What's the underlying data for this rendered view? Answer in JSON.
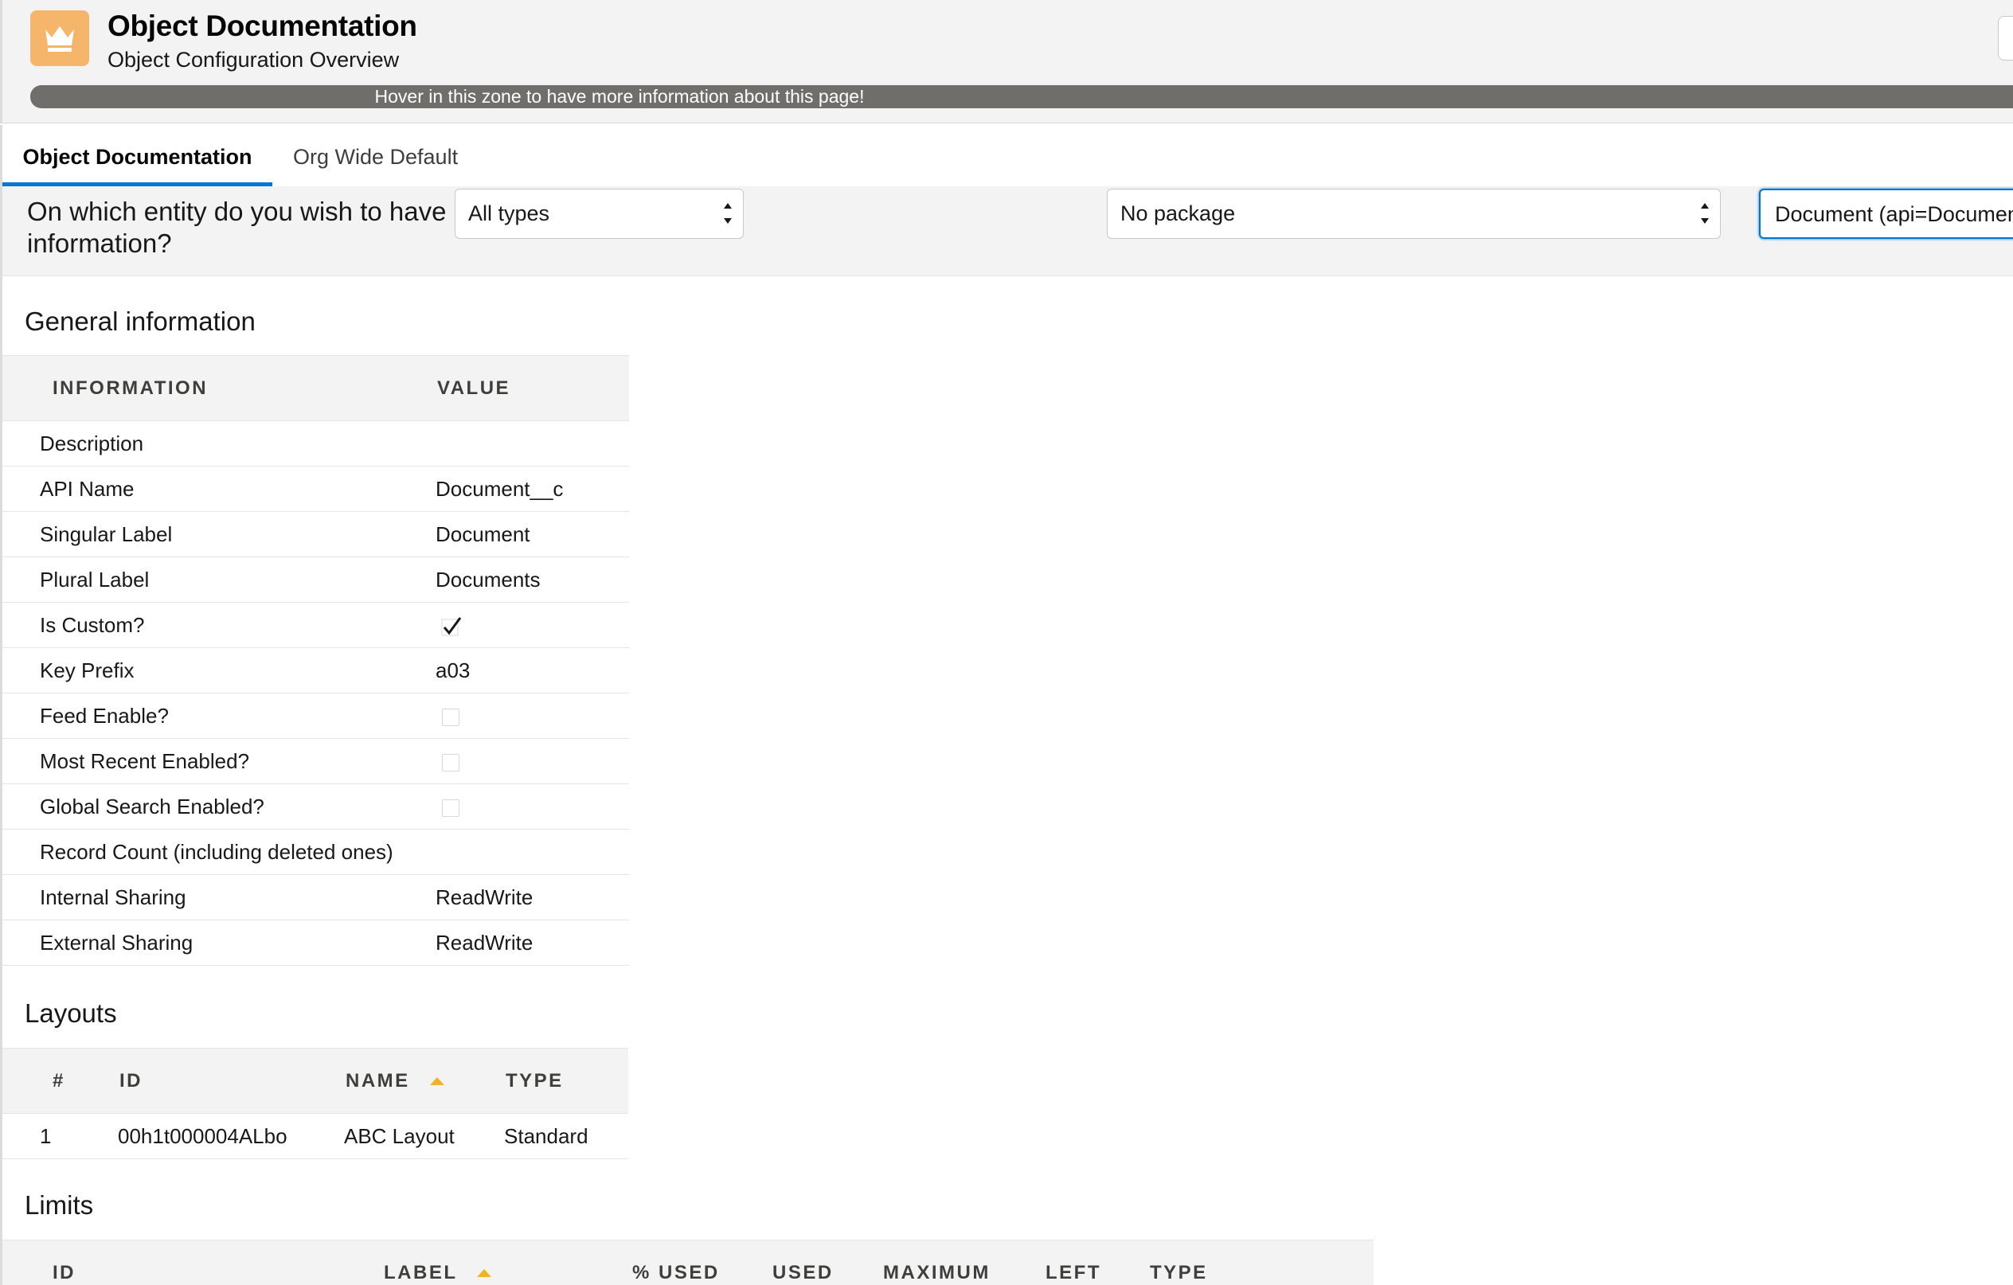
{
  "header": {
    "title": "Object Documentation",
    "subtitle": "Object Configuration Overview",
    "info_bar": "Hover in this zone to have more information about this page!",
    "icon": "crown-icon",
    "icon_color": "#f5b56a"
  },
  "tabs": [
    {
      "label": "Object Documentation",
      "active": true
    },
    {
      "label": "Org Wide Default",
      "active": false
    }
  ],
  "filters": {
    "question": "On which entity do you wish to have information?",
    "type_select": "All types",
    "package_select": "No package",
    "object_select": "Document (api=Document__c)"
  },
  "general": {
    "title": "General information",
    "columns": [
      "Information",
      "Value"
    ],
    "rows": [
      {
        "label": "Description",
        "value": ""
      },
      {
        "label": "API Name",
        "value": "Document__c"
      },
      {
        "label": "Singular Label",
        "value": "Document"
      },
      {
        "label": "Plural Label",
        "value": "Documents"
      },
      {
        "label": "Is Custom?",
        "value": "",
        "checkbox": true,
        "checked": true
      },
      {
        "label": "Key Prefix",
        "value": "a03"
      },
      {
        "label": "Feed Enable?",
        "value": "",
        "checkbox": true,
        "checked": false
      },
      {
        "label": "Most Recent Enabled?",
        "value": "",
        "checkbox": true,
        "checked": false
      },
      {
        "label": "Global Search Enabled?",
        "value": "",
        "checkbox": true,
        "checked": false
      },
      {
        "label": "Record Count (including deleted ones)",
        "value": ""
      },
      {
        "label": "Internal Sharing",
        "value": "ReadWrite"
      },
      {
        "label": "External Sharing",
        "value": "ReadWrite"
      }
    ]
  },
  "layouts": {
    "title": "Layouts",
    "columns": [
      "#",
      "ID",
      "Name",
      "Type"
    ],
    "rows": [
      {
        "num": "1",
        "id": "00h1t000004ALbo",
        "name": "ABC Layout",
        "type": "Standard"
      }
    ]
  },
  "limits": {
    "title": "Limits",
    "columns": [
      "ID",
      "Label",
      "% Used",
      "Used",
      "Maximum",
      "Left",
      "Type"
    ]
  },
  "colors": {
    "accent": "#0176d3",
    "sort_arrow": "#f0b323",
    "info_bar": "#706e6b"
  }
}
